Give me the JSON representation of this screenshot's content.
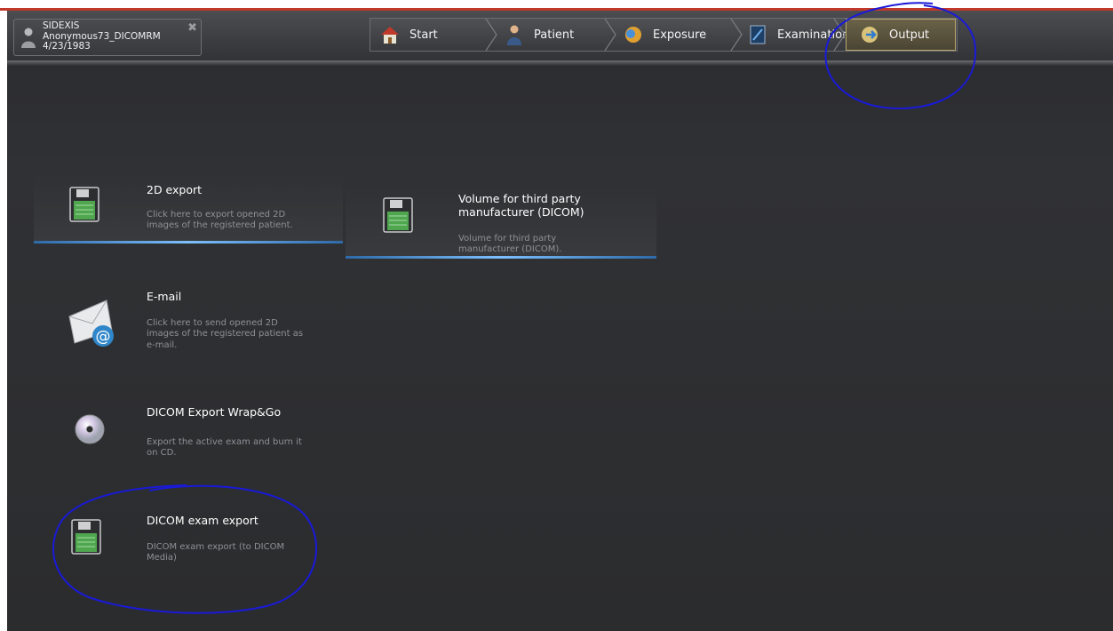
{
  "patient": {
    "app_name": "SIDEXIS",
    "name": "Anonymous73_DICOMRM",
    "dob": "4/23/1983"
  },
  "wizard": {
    "steps": [
      {
        "label": "Start",
        "icon": "house-icon"
      },
      {
        "label": "Patient",
        "icon": "patient-icon"
      },
      {
        "label": "Exposure",
        "icon": "exposure-icon"
      },
      {
        "label": "Examination",
        "icon": "examination-icon"
      },
      {
        "label": "Output",
        "icon": "output-icon",
        "active": true
      }
    ]
  },
  "export_options": [
    {
      "title": "2D export",
      "description": "Click here to export opened 2D images of the registered patient.",
      "icon": "floppy-disk-icon"
    },
    {
      "title": "Volume for third party manufacturer (DICOM)",
      "description": "Volume for third party manufacturer (DICOM).",
      "icon": "floppy-disk-icon"
    },
    {
      "title": "E-mail",
      "description": "Click here to send opened 2D images of the registered patient as e-mail.",
      "icon": "email-icon"
    },
    {
      "title": "DICOM Export Wrap&Go",
      "description": "Export the active exam and burn it on CD.",
      "icon": "cd-icon"
    },
    {
      "title": "DICOM exam export",
      "description": "DICOM exam export (to DICOM Media)",
      "icon": "floppy-disk-icon"
    }
  ],
  "colors": {
    "background": "#2b2c2e",
    "accent_underline": "#5aa8f0",
    "annotation": "#1a1ad8",
    "active_step_border": "#b9a86d"
  }
}
